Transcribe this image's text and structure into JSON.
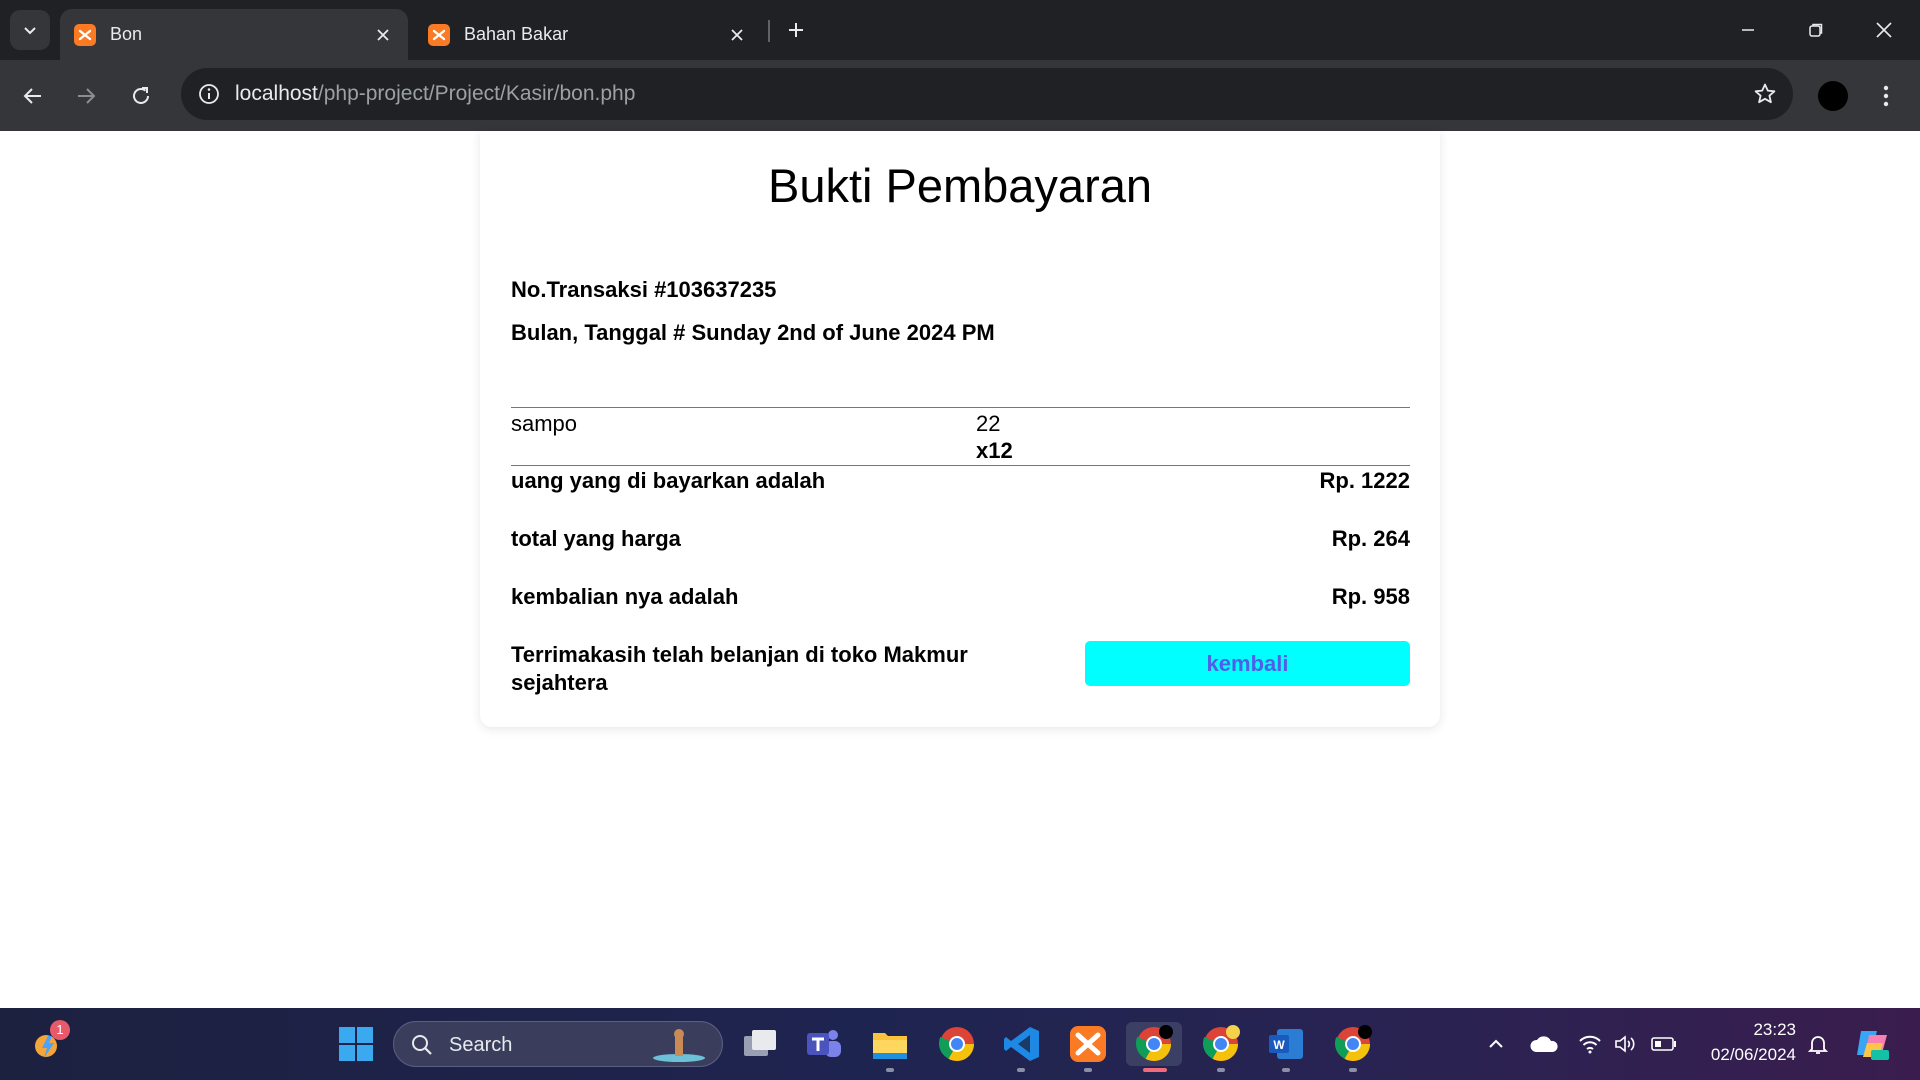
{
  "browser": {
    "tabs": [
      {
        "title": "Bon",
        "active": true
      },
      {
        "title": "Bahan Bakar",
        "active": false
      }
    ],
    "address": {
      "host": "localhost",
      "path": "/php-project/Project/Kasir/bon.php"
    }
  },
  "receipt": {
    "title": "Bukti Pembayaran",
    "transaction": "No.Transaksi #103637235",
    "date": "Bulan, Tanggal # Sunday 2nd of June 2024 PM",
    "items": [
      {
        "name": "sampo",
        "price": "22",
        "qty": "x12"
      }
    ],
    "paid_label": "uang yang di bayarkan adalah",
    "paid_value": "Rp. 1222",
    "total_label": "total yang harga",
    "total_value": "Rp. 264",
    "change_label": "kembalian nya adalah",
    "change_value": "Rp. 958",
    "thanks_line1": "Terrimakasih telah belanjan di toko Makmur",
    "thanks_line2": "sejahtera",
    "back_button": "kembali"
  },
  "taskbar": {
    "search_label": "Search",
    "widget_badge": "1",
    "time": "23:23",
    "date": "02/06/2024"
  },
  "colors": {
    "button_bg": "#00ffff",
    "button_text": "#4f5fe8",
    "chrome_dark": "#202124",
    "chrome_toolbar": "#35363a"
  }
}
